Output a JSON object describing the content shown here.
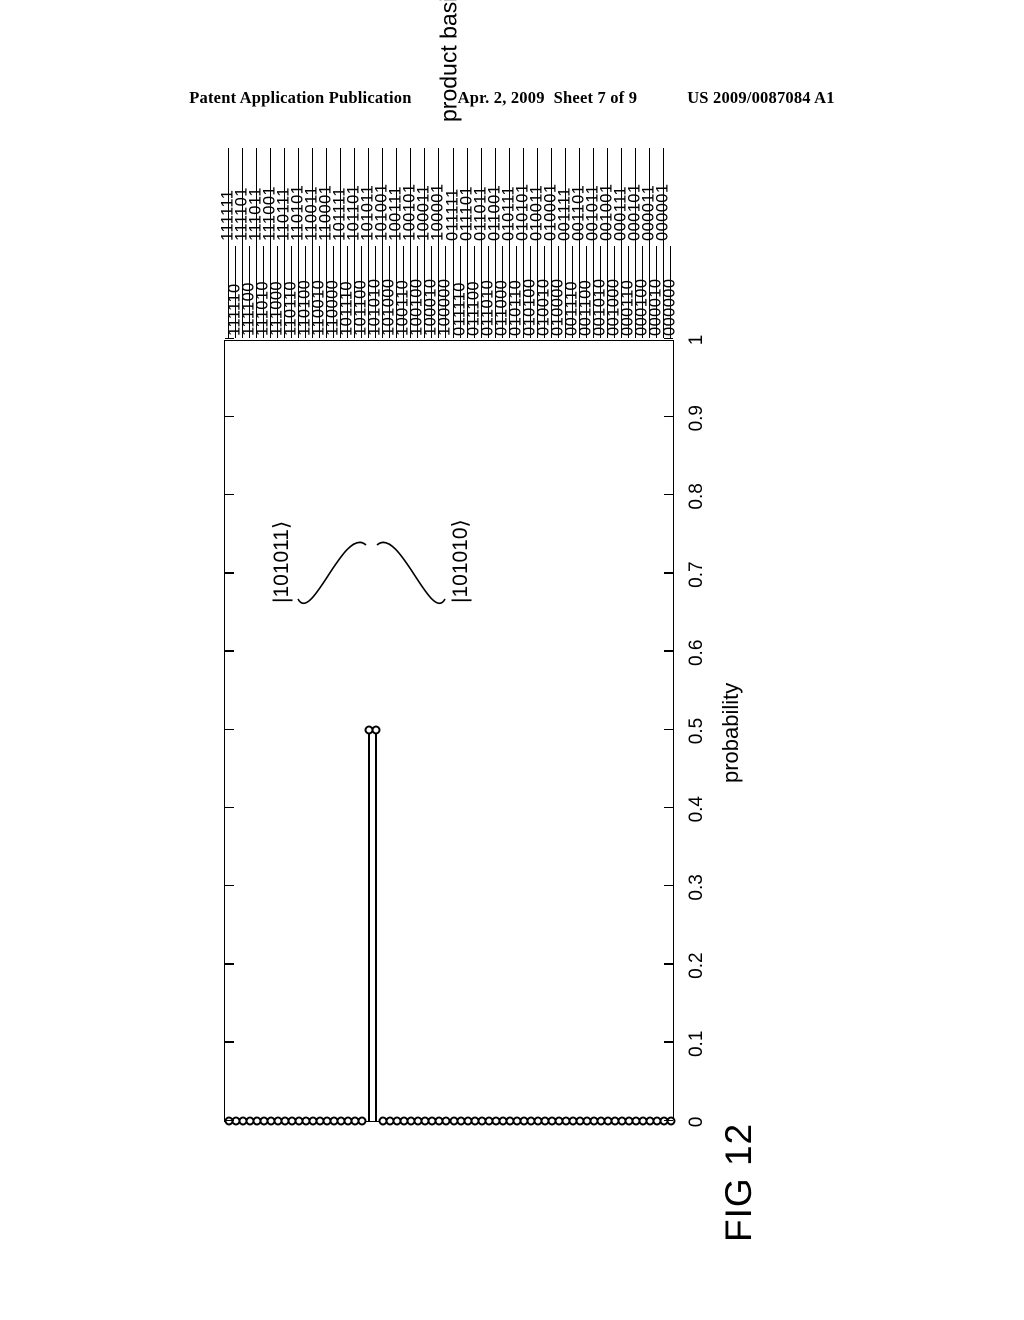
{
  "header": {
    "publication": "Patent Application Publication",
    "date": "Apr. 2, 2009",
    "sheet": "Sheet 7 of 9",
    "patent_number": "US 2009/0087084 A1"
  },
  "figure": {
    "caption": "FIG 12"
  },
  "chart_data": {
    "type": "bar",
    "title": "FIG 12",
    "orientation": "horizontal",
    "xlabel": "product basis",
    "ylabel": "probability",
    "ylim": [
      0,
      1
    ],
    "yticks": [
      "1",
      "0.9",
      "0.8",
      "0.7",
      "0.6",
      "0.5",
      "0.4",
      "0.3",
      "0.2",
      "0.1",
      "0"
    ],
    "grid": false,
    "marker": "open-circle",
    "categories": [
      "000000",
      "000001",
      "000010",
      "000011",
      "000100",
      "000101",
      "000110",
      "000111",
      "001000",
      "001001",
      "001010",
      "001011",
      "001100",
      "001101",
      "001110",
      "001111",
      "010000",
      "010001",
      "010010",
      "010011",
      "010100",
      "010101",
      "010110",
      "010111",
      "011000",
      "011001",
      "011010",
      "011011",
      "011100",
      "011101",
      "011110",
      "011111",
      "100000",
      "100001",
      "100010",
      "100011",
      "100100",
      "100101",
      "100110",
      "100111",
      "101000",
      "101001",
      "101010",
      "101011",
      "101100",
      "101101",
      "101110",
      "101111",
      "110000",
      "110001",
      "110010",
      "110011",
      "110100",
      "110101",
      "110110",
      "110111",
      "111000",
      "111001",
      "111010",
      "111011",
      "111100",
      "111101",
      "111110",
      "111111"
    ],
    "values": [
      0,
      0,
      0,
      0,
      0,
      0,
      0,
      0,
      0,
      0,
      0,
      0,
      0,
      0,
      0,
      0,
      0,
      0,
      0,
      0,
      0,
      0,
      0,
      0,
      0,
      0,
      0,
      0,
      0,
      0,
      0,
      0,
      0,
      0,
      0,
      0,
      0,
      0,
      0,
      0,
      0,
      0,
      0.5,
      0.5,
      0,
      0,
      0,
      0,
      0,
      0,
      0,
      0,
      0,
      0,
      0,
      0,
      0,
      0,
      0,
      0,
      0,
      0,
      0,
      0
    ],
    "annotations": [
      {
        "label": "|101010⟩",
        "category": "101010",
        "value": 0.5
      },
      {
        "label": "|101011⟩",
        "category": "101011",
        "value": 0.5
      }
    ]
  }
}
